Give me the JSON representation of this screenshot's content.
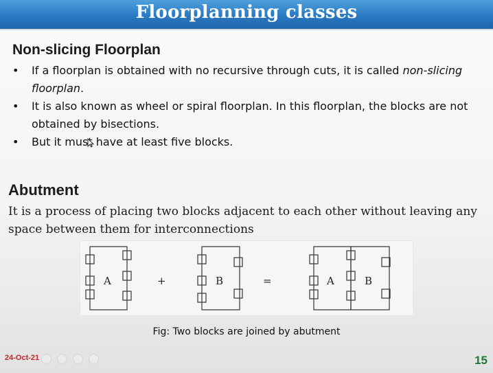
{
  "slide": {
    "title": "Floorplanning classes",
    "section1": {
      "heading": "Non-slicing Floorplan",
      "bullets": [
        {
          "text": "If a floorplan is obtained with no recursive through cuts, it is called ",
          "italic": "non-slicing floorplan",
          "tail": "."
        },
        {
          "text": "It is also known as wheel or spiral floorplan. In this floorplan, the blocks are not obtained by bisections."
        },
        {
          "text": "But it must have at least five blocks."
        }
      ],
      "bullet_symbol": "•"
    },
    "section2": {
      "heading": "Abutment",
      "paragraph": "It is a process of placing two blocks adjacent to each other without leaving any space between them for interconnections"
    },
    "figure": {
      "caption": "Fig: Two blocks are joined by abutment",
      "block_a_label": "A",
      "block_b_label": "B",
      "plus_sign": "+",
      "equals_sign": "=",
      "combined_a_label": "A",
      "combined_b_label": "B"
    },
    "footer": {
      "date": "24-Oct-21",
      "page_number": "15",
      "date_color": "#c0262d",
      "page_color": "#1d7a36"
    },
    "colors": {
      "title_bar": "#2a79c2",
      "title_text": "#ffffff"
    }
  }
}
